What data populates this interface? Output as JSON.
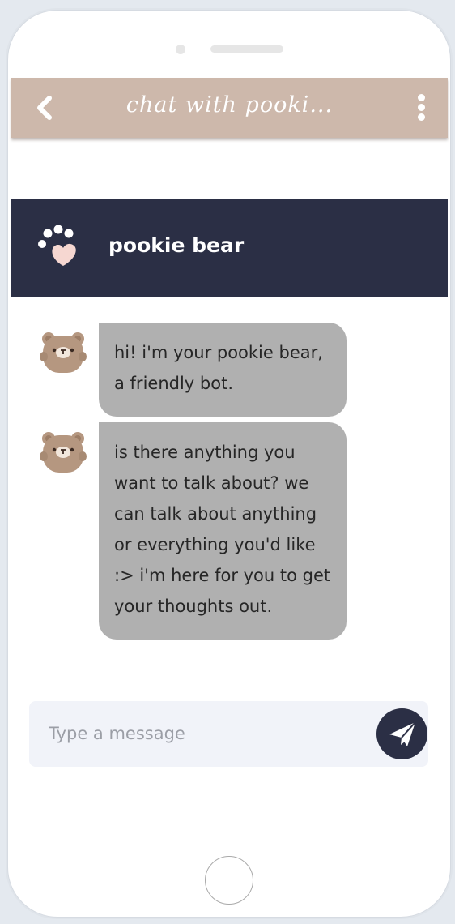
{
  "topbar": {
    "title": "chat with pooki...",
    "back_icon": "chevron-left-icon",
    "menu_icon": "kebab-menu-icon",
    "color": "#cdb8ab"
  },
  "bot": {
    "name": "pookie bear",
    "icon": "paw-icon",
    "header_color": "#2b2f45"
  },
  "messages": [
    {
      "sender": "bot",
      "avatar": "bear-avatar-icon",
      "text": "hi! i'm your pookie bear, a friendly bot."
    },
    {
      "sender": "bot",
      "avatar": "bear-avatar-icon",
      "text": "is there anything you want to talk about? we can talk about anything or everything you'd like :> i'm here for you to get your thoughts out."
    }
  ],
  "composer": {
    "value": "",
    "placeholder": "Type a message",
    "send_icon": "paper-plane-icon"
  },
  "colors": {
    "bubble": "#b0b0b0",
    "accent": "#2b2f45"
  }
}
